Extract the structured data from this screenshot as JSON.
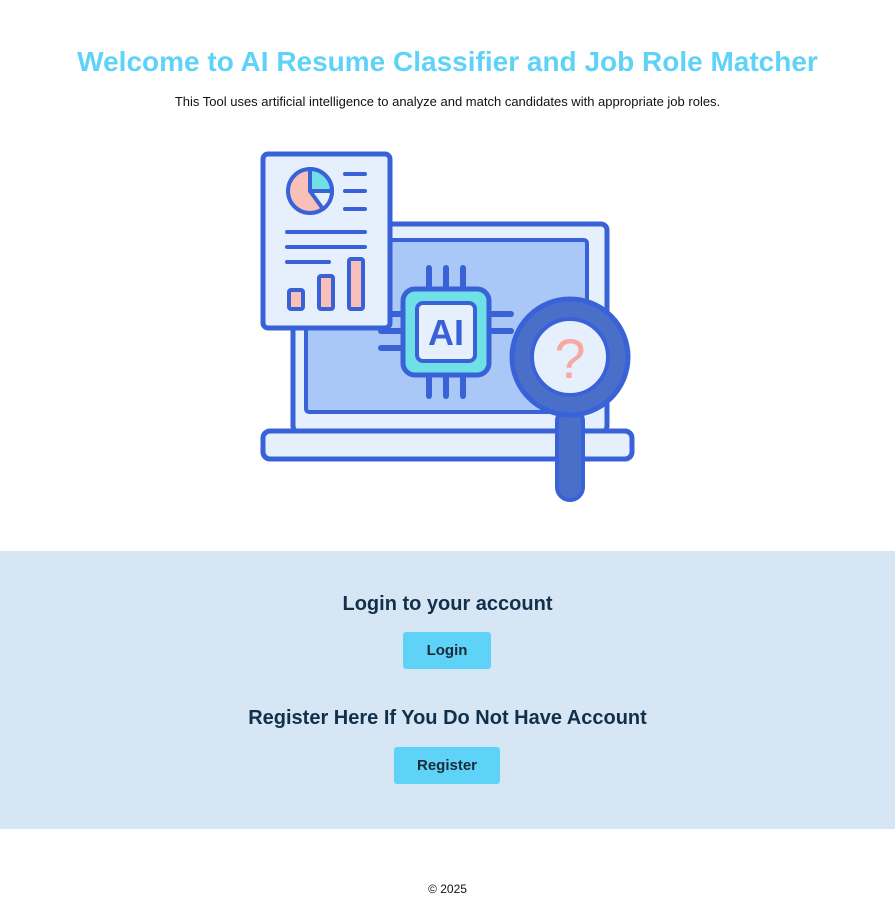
{
  "hero": {
    "title": "Welcome to AI Resume Classifier and Job Role Matcher",
    "subtitle": "This Tool uses artificial intelligence to analyze and match candidates with appropriate job roles."
  },
  "illustration": {
    "chip_label": "AI",
    "question_mark": "?",
    "colors": {
      "outline": "#3a62d8",
      "screen": "#a9c8f8",
      "paper": "#e6f0fd",
      "chip": "#6fe0e6",
      "accent_pink": "#f8c0b8",
      "magnifier": "#4a6fc9"
    }
  },
  "auth": {
    "login_heading": "Login to your account",
    "login_button": "Login",
    "register_heading": "Register Here If You Do Not Have Account",
    "register_button": "Register"
  },
  "footer": {
    "copyright": "© 2025"
  },
  "theme": {
    "accent": "#5fd3f7",
    "band_background": "#d7e6f5",
    "heading_color": "#12304a"
  }
}
